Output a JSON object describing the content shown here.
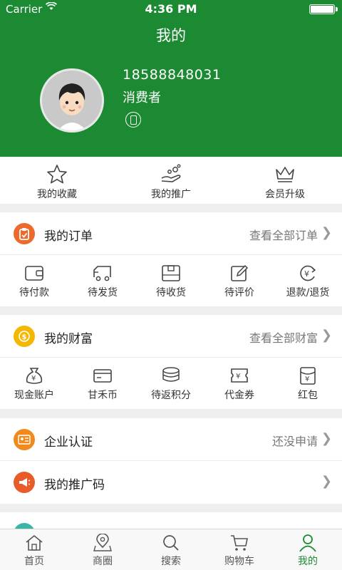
{
  "status": {
    "carrier": "Carrier",
    "time": "4:36 PM"
  },
  "header": {
    "title": "我的",
    "phone": "18588848031",
    "role": "消费者"
  },
  "quick": [
    {
      "label": "我的收藏",
      "icon": "star-icon"
    },
    {
      "label": "我的推广",
      "icon": "hand-coins-icon"
    },
    {
      "label": "会员升级",
      "icon": "crown-icon"
    }
  ],
  "orders": {
    "title": "我的订单",
    "more": "查看全部订单",
    "items": [
      "待付款",
      "待发货",
      "待收货",
      "待评价",
      "退款/退货"
    ]
  },
  "wealth": {
    "title": "我的财富",
    "more": "查看全部财富",
    "items": [
      "现金账户",
      "甘禾币",
      "待返积分",
      "代金券",
      "红包"
    ]
  },
  "enterprise": {
    "title": "企业认证",
    "status": "还没申请"
  },
  "promo_code": {
    "title": "我的推广码"
  },
  "colors": {
    "brand": "#1c8a33",
    "orders_icon": "#ec6a2c",
    "wealth_icon": "#f5b800",
    "enterprise_icon": "#f08a1c",
    "promo_icon": "#e85c2a"
  },
  "tabs": [
    {
      "label": "首页",
      "icon": "home-icon",
      "active": false
    },
    {
      "label": "商圈",
      "icon": "map-pin-icon",
      "active": false
    },
    {
      "label": "搜索",
      "icon": "search-icon",
      "active": false
    },
    {
      "label": "购物车",
      "icon": "cart-icon",
      "active": false
    },
    {
      "label": "我的",
      "icon": "user-icon",
      "active": true
    }
  ]
}
